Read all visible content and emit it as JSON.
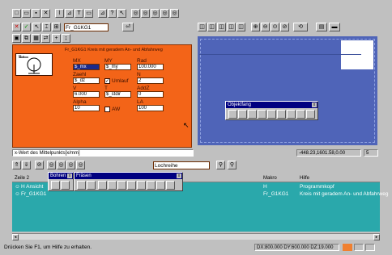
{
  "colors": {
    "dialog_bg": "#f36418",
    "canvas_bg": "#4f64b8",
    "grid_bg": "#2aa8ab",
    "title_blue": "#000080",
    "status_accent": "#f08030"
  },
  "toolbar_top": {
    "icons": [
      "new-icon",
      "open-icon",
      "save-icon",
      "tools-icon",
      "signature-icon",
      "mirror-icon",
      "text-icon",
      "rect-icon",
      "edit-icon",
      "help-icon",
      "context-help-icon",
      "tool1-icon",
      "tool2-icon",
      "tool3-icon",
      "tool4-icon",
      "tool5-icon"
    ]
  },
  "toolbar_left": {
    "combo_value": "Fr_G1KG1"
  },
  "dialog": {
    "header": "Fr_G1KG1 Kreis mit geradem An- und Abfahrweg",
    "preview_label": "R-r",
    "labels": {
      "mx": "MX",
      "my": "MY",
      "rad": "Rad",
      "zaehl": "Zaehl",
      "umlauf": "Umlauf",
      "n": "N",
      "v": "V",
      "t": "T",
      "addz": "AddZ",
      "alpha": "Alpha",
      "aw": "AW",
      "la": "LA"
    },
    "values": {
      "mx": "$_mx",
      "my": "$_my",
      "rad": "100.000",
      "zaehl": "$_dz",
      "n": "2",
      "v": "6.000",
      "t": "$_stdir",
      "addz": "0",
      "alpha": "10",
      "la": "100"
    },
    "umlauf_checked": true,
    "aw_checked": false
  },
  "status_left": "x-Wert des Mittelpunkts[x/mm]",
  "coords_readout": "-448.23,1601.58,0.00",
  "coords_page": "5",
  "object_palette": {
    "title": "Objektfang"
  },
  "grid_toolbar": {
    "combo_value": "Lochreihe"
  },
  "bohren_palette": {
    "title": "Bohren"
  },
  "fraesen_palette": {
    "title": "Fräsen"
  },
  "table": {
    "headers": {
      "zeile": "Zeile 2",
      "makro": "Makro",
      "hilfe": "Hilfe"
    },
    "rows": [
      {
        "zeile": "H Ansicht",
        "makro": "H",
        "hilfe": "Programmkopf"
      },
      {
        "zeile": "Fr_G1KG1",
        "makro": "Fr_G1KG1",
        "hilfe": "Kreis mit geradem An- und Abfahrweg"
      }
    ]
  },
  "statusbar": {
    "help": "Drücken Sie F1, um Hilfe zu erhalten.",
    "dims": "DX:800.000 DY:600.000 DZ:19.000"
  }
}
